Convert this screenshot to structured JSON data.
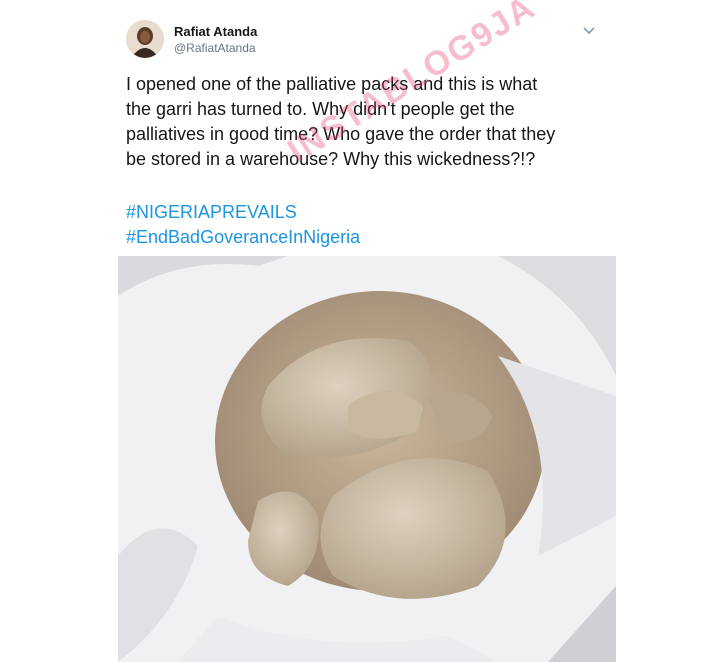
{
  "tweet": {
    "author_name": "Rafiat Atanda",
    "author_handle": "@RafiatAtanda",
    "text_lines": [
      "I opened one of the palliative packs and this is what",
      "the garri has turned to. Why didn't people get the",
      "palliatives in good time? Who gave the order that they",
      "be stored in a warehouse? Why this wickedness?!?"
    ],
    "hashtags": [
      "#NIGERIAPREVAILS",
      "#EndBadGoveranceInNigeria"
    ],
    "watermark": "INSTABLOG9JA",
    "icons": {
      "menu": "chevron-down-icon",
      "avatar": "avatar"
    },
    "colors": {
      "text": "#14171a",
      "handle": "#657786",
      "hashtag": "#1b95e0"
    }
  }
}
